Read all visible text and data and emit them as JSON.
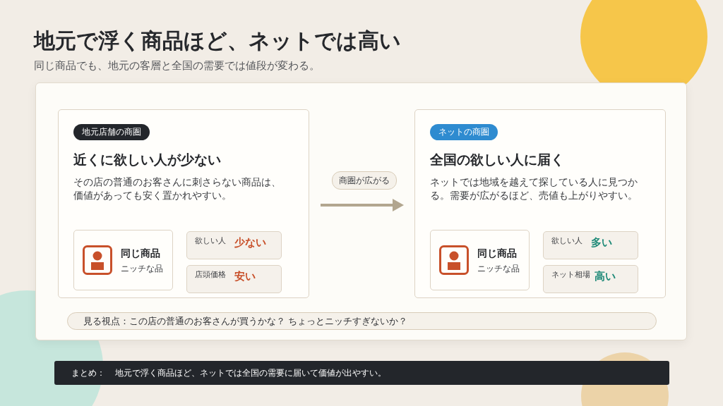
{
  "title": "地元で浮く商品ほど、ネットでは高い",
  "subtitle": "同じ商品でも、地元の客層と全国の需要では値段が変わる。",
  "panels": [
    {
      "tag": "地元店舗の商圏",
      "color": "#23262b",
      "heading": "近くに欲しい人が少ない",
      "body": "その店の普通のお客さんに刺さらない商品は、価値があっても安く置かれやすい。",
      "product": {
        "name": "同じ商品",
        "note": "ニッチな品"
      },
      "metrics": [
        {
          "label": "欲しい人",
          "value": "少ない",
          "color": "#c8502a"
        },
        {
          "label": "店頭価格",
          "value": "安い",
          "color": "#c8502a"
        }
      ]
    },
    {
      "tag": "ネットの商圏",
      "color": "#2e8bd0",
      "heading": "全国の欲しい人に届く",
      "body": "ネットでは地域を越えて探している人に見つかる。需要が広がるほど、売値も上がりやすい。",
      "product": {
        "name": "同じ商品",
        "note": "ニッチな品"
      },
      "metrics": [
        {
          "label": "欲しい人",
          "value": "多い",
          "color": "#1f8a78"
        },
        {
          "label": "ネット相場",
          "value": "高い",
          "color": "#1f8a78"
        }
      ]
    }
  ],
  "connector": {
    "label": "商圏が広がる"
  },
  "viewpoint": "見る視点：この店の普通のお客さんが買うかな？ ちょっとニッチすぎないか？",
  "summary": {
    "label": "まとめ：",
    "text": "地元で浮く商品ほど、ネットでは全国の需要に届いて価値が出やすい。"
  }
}
